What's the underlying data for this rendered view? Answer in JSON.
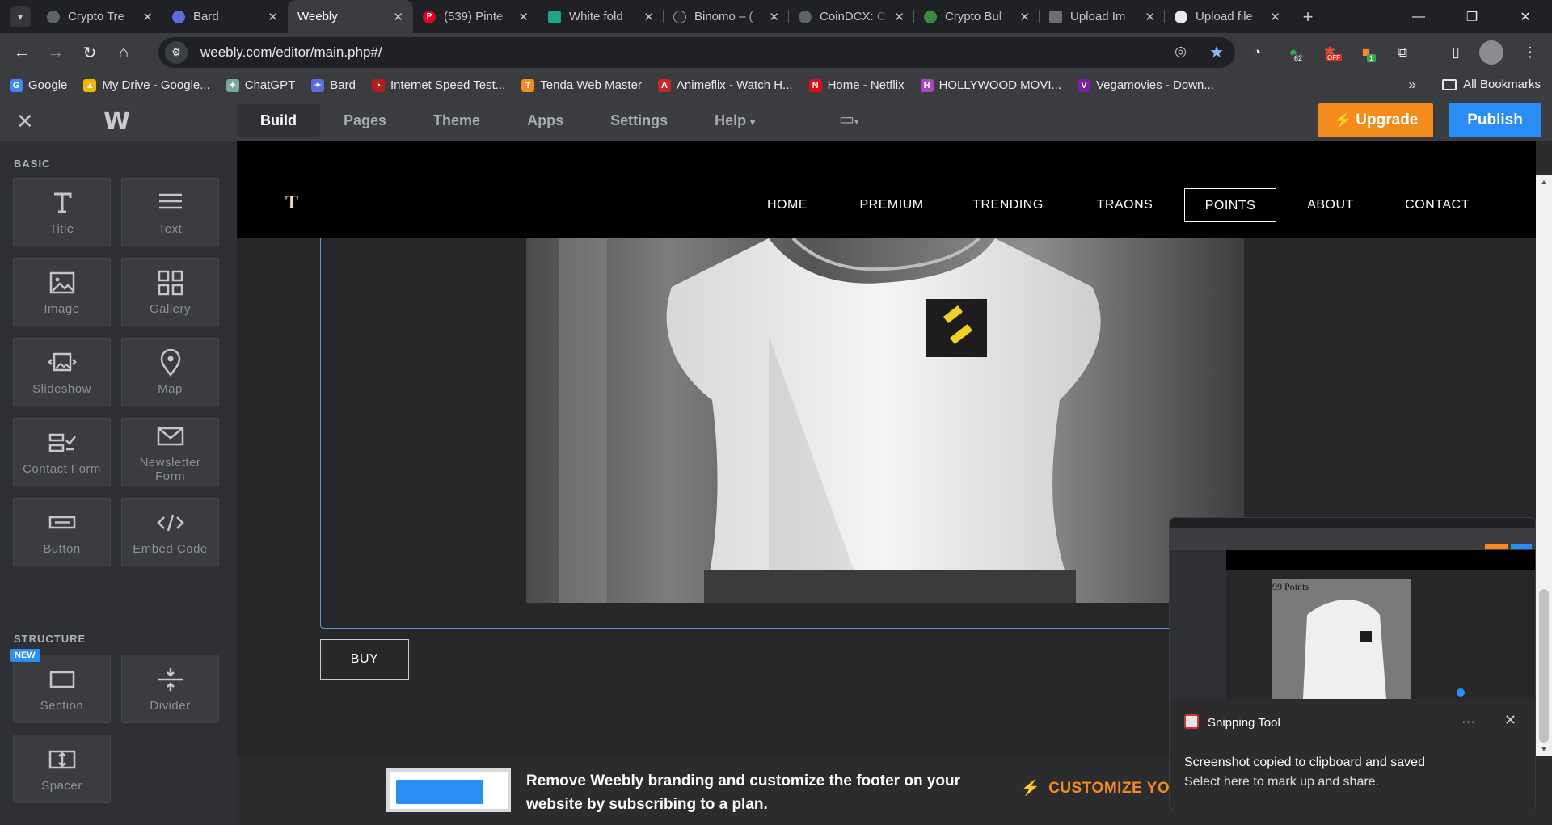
{
  "browser": {
    "tabs": [
      {
        "title": "Crypto Tre",
        "fav": "#5f6368"
      },
      {
        "title": "Bard",
        "fav": "#5b6be0"
      },
      {
        "title": "Weebly",
        "fav": "",
        "active": true
      },
      {
        "title": "(539) Pinte",
        "fav": "#e60023"
      },
      {
        "title": "White fold",
        "fav": "#1ea58a"
      },
      {
        "title": "Binomo – (",
        "fav": "#2a2a2a"
      },
      {
        "title": "CoinDCX: C",
        "fav": "#5f6368"
      },
      {
        "title": "Crypto Bul",
        "fav": "#3c8a40"
      },
      {
        "title": "Upload Im",
        "fav": "#6e6e6e"
      },
      {
        "title": "Upload file",
        "fav": "#e8eaed"
      }
    ],
    "url": "weebly.com/editor/main.php#/",
    "bookmarks": [
      {
        "label": "Google",
        "color": "#4285f4",
        "glyph": "G"
      },
      {
        "label": "My Drive - Google...",
        "color": "#f4b400",
        "glyph": "▲"
      },
      {
        "label": "ChatGPT",
        "color": "#74aa9c",
        "glyph": "✦"
      },
      {
        "label": "Bard",
        "color": "#5b6be0",
        "glyph": "✦"
      },
      {
        "label": "Internet Speed Test...",
        "color": "#b71c1c",
        "glyph": "◔"
      },
      {
        "label": "Tenda Web Master",
        "color": "#f58b1c",
        "glyph": "T"
      },
      {
        "label": "Animeflix - Watch H...",
        "color": "#c62828",
        "glyph": "A"
      },
      {
        "label": "Home - Netflix",
        "color": "#e50914",
        "glyph": "N"
      },
      {
        "label": "HOLLYWOOD MOVI...",
        "color": "#ab47bc",
        "glyph": "H"
      },
      {
        "label": "Vegamovies - Down...",
        "color": "#7b1fa2",
        "glyph": "V"
      }
    ],
    "all_bookmarks": "All Bookmarks",
    "ext_badges": {
      "count": "62",
      "off": "OFF",
      "one": "1"
    }
  },
  "editor": {
    "nav": [
      "Build",
      "Pages",
      "Theme",
      "Apps",
      "Settings",
      "Help"
    ],
    "upgrade": "Upgrade",
    "publish": "Publish",
    "sections": {
      "basic": "BASIC",
      "structure": "STRUCTURE"
    },
    "elements": {
      "title": "Title",
      "text": "Text",
      "image": "Image",
      "gallery": "Gallery",
      "slideshow": "Slideshow",
      "map": "Map",
      "contact": "Contact Form",
      "newsletter": "Newsletter Form",
      "button": "Button",
      "embed": "Embed Code",
      "section": "Section",
      "divider": "Divider",
      "spacer": "Spacer"
    },
    "new_badge": "NEW"
  },
  "site": {
    "logo": "T",
    "nav": [
      "HOME",
      "PREMIUM",
      "TRENDING",
      "TRAONS",
      "POINTS",
      "ABOUT",
      "CONTACT"
    ],
    "active_nav": "POINTS",
    "buy": "BUY"
  },
  "footer": {
    "text": "Remove Weebly branding and customize the footer on your website by subscribing to a plan.",
    "cta": "CUSTOMIZE YO"
  },
  "snip": {
    "app": "Snipping Tool",
    "line1": "Screenshot copied to clipboard and saved",
    "line2": "Select here to mark up and share.",
    "thumb_caption": "99 Points"
  },
  "colors": {
    "accent": "#2a8cf5",
    "upgrade": "#f58b1c",
    "selection": "#5d9ad6",
    "logo_yellow": "#f4d020"
  }
}
